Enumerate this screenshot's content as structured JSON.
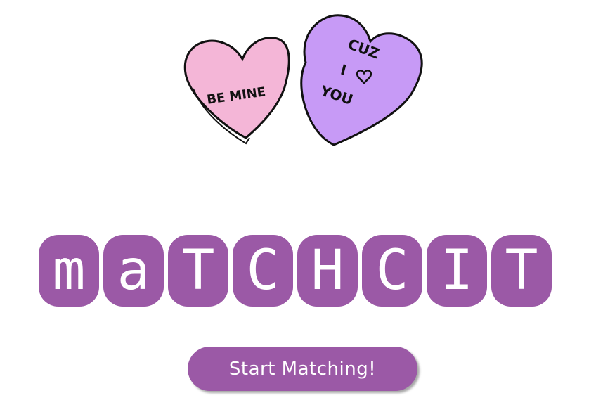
{
  "hearts": {
    "left_text": "BE MINE",
    "right_lines": [
      "CUZ",
      "I",
      "YOU"
    ],
    "left_color": "#f4b6d7",
    "right_color": "#c79af6"
  },
  "title": {
    "letters": [
      "m",
      "a",
      "T",
      "C",
      "H",
      "C",
      "I",
      "T"
    ]
  },
  "start_button": {
    "label": "Start Matching!"
  },
  "colors": {
    "accent": "#9b59a6",
    "background": "#ffffff"
  }
}
